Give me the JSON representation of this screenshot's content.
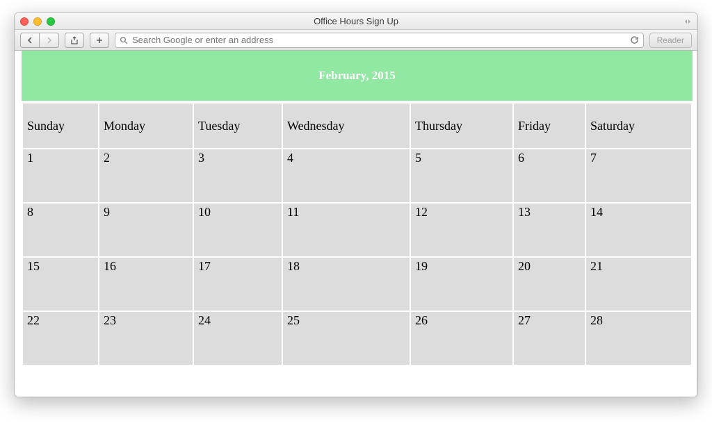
{
  "window": {
    "title": "Office Hours Sign Up"
  },
  "toolbar": {
    "address_placeholder": "Search Google or enter an address",
    "reader_label": "Reader"
  },
  "calendar": {
    "title": "February, 2015",
    "day_headers": [
      "Sunday",
      "Monday",
      "Tuesday",
      "Wednesday",
      "Thursday",
      "Friday",
      "Saturday"
    ],
    "weeks": [
      [
        "1",
        "2",
        "3",
        "4",
        "5",
        "6",
        "7"
      ],
      [
        "8",
        "9",
        "10",
        "11",
        "12",
        "13",
        "14"
      ],
      [
        "15",
        "16",
        "17",
        "18",
        "19",
        "20",
        "21"
      ],
      [
        "22",
        "23",
        "24",
        "25",
        "26",
        "27",
        "28"
      ]
    ]
  }
}
